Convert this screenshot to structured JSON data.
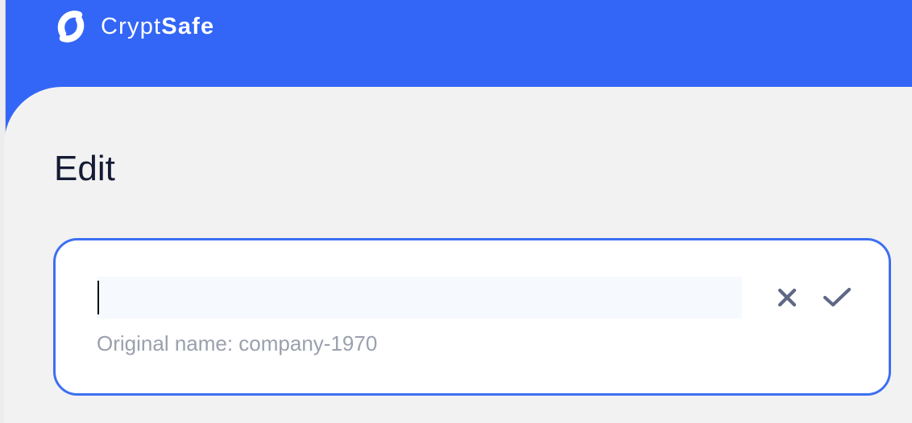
{
  "app": {
    "brand_light": "Crypt",
    "brand_bold": "Safe",
    "logo_icon": "cryptsafe-logo-icon"
  },
  "page": {
    "title": "Edit"
  },
  "edit_form": {
    "name_value": "",
    "hint": "Original name: company-1970",
    "cancel_icon": "close-icon",
    "confirm_icon": "check-icon"
  },
  "colors": {
    "header": "#3366f6",
    "background": "#f2f2f2",
    "card_border": "#3d6ff0",
    "input_background": "#f6f9fd",
    "icon": "#5f6885",
    "hint_text": "#9aa0ad",
    "title_text": "#141b34"
  }
}
